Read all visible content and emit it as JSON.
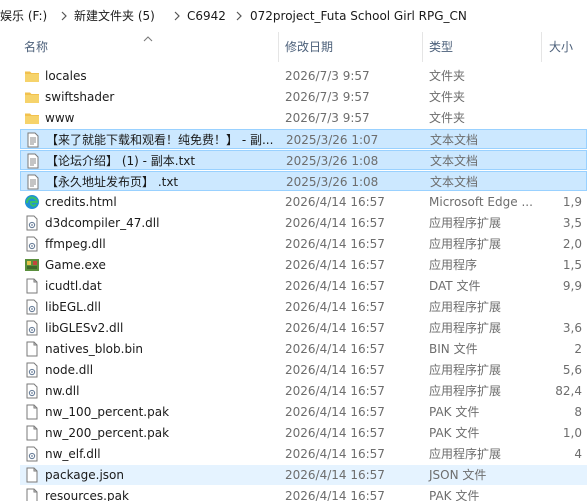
{
  "breadcrumb": [
    {
      "label": "娱乐 (F:)"
    },
    {
      "label": "新建文件夹 (5)"
    },
    {
      "label": "C6942"
    },
    {
      "label": "072project_Futa School Girl RPG_CN"
    }
  ],
  "columns": {
    "name": "名称",
    "date": "修改日期",
    "type": "类型",
    "size": "大小"
  },
  "colors": {
    "selected_bg": "#cce8ff",
    "selected_border": "#99d1ff",
    "hover_bg": "#e5f3ff",
    "folder": "#f2c14e"
  },
  "files": [
    {
      "name": "locales",
      "date": "2026/7/3 9:57",
      "type": "文件夹",
      "size": "",
      "icon": "folder-icon"
    },
    {
      "name": "swiftshader",
      "date": "2026/7/3 9:57",
      "type": "文件夹",
      "size": "",
      "icon": "folder-icon"
    },
    {
      "name": "www",
      "date": "2026/7/3 9:57",
      "type": "文件夹",
      "size": "",
      "icon": "folder-icon"
    },
    {
      "name": "【来了就能下载和观看！纯免费！】 - 副...",
      "date": "2025/3/26 1:07",
      "type": "文本文档",
      "size": "",
      "icon": "text-file-icon",
      "selected": true
    },
    {
      "name": "【论坛介绍】 (1) - 副本.txt",
      "date": "2025/3/26 1:08",
      "type": "文本文档",
      "size": "",
      "icon": "text-file-icon",
      "selected": true
    },
    {
      "name": "【永久地址发布页】 .txt",
      "date": "2025/3/26 1:08",
      "type": "文本文档",
      "size": "",
      "icon": "text-file-icon",
      "selected": true
    },
    {
      "name": "credits.html",
      "date": "2026/4/14 16:57",
      "type": "Microsoft Edge ...",
      "size": "1,9",
      "icon": "edge-icon"
    },
    {
      "name": "d3dcompiler_47.dll",
      "date": "2026/4/14 16:57",
      "type": "应用程序扩展",
      "size": "3,5",
      "icon": "dll-file-icon"
    },
    {
      "name": "ffmpeg.dll",
      "date": "2026/4/14 16:57",
      "type": "应用程序扩展",
      "size": "2,0",
      "icon": "dll-file-icon"
    },
    {
      "name": "Game.exe",
      "date": "2026/4/14 16:57",
      "type": "应用程序",
      "size": "1,5",
      "icon": "game-exe-icon"
    },
    {
      "name": "icudtl.dat",
      "date": "2026/4/14 16:57",
      "type": "DAT 文件",
      "size": "9,9",
      "icon": "blank-file-icon"
    },
    {
      "name": "libEGL.dll",
      "date": "2026/4/14 16:57",
      "type": "应用程序扩展",
      "size": "",
      "icon": "dll-file-icon"
    },
    {
      "name": "libGLESv2.dll",
      "date": "2026/4/14 16:57",
      "type": "应用程序扩展",
      "size": "3,6",
      "icon": "dll-file-icon"
    },
    {
      "name": "natives_blob.bin",
      "date": "2026/4/14 16:57",
      "type": "BIN 文件",
      "size": "2",
      "icon": "blank-file-icon"
    },
    {
      "name": "node.dll",
      "date": "2026/4/14 16:57",
      "type": "应用程序扩展",
      "size": "5,6",
      "icon": "dll-file-icon"
    },
    {
      "name": "nw.dll",
      "date": "2026/4/14 16:57",
      "type": "应用程序扩展",
      "size": "82,4",
      "icon": "dll-file-icon"
    },
    {
      "name": "nw_100_percent.pak",
      "date": "2026/4/14 16:57",
      "type": "PAK 文件",
      "size": "8",
      "icon": "blank-file-icon"
    },
    {
      "name": "nw_200_percent.pak",
      "date": "2026/4/14 16:57",
      "type": "PAK 文件",
      "size": "1,0",
      "icon": "blank-file-icon"
    },
    {
      "name": "nw_elf.dll",
      "date": "2026/4/14 16:57",
      "type": "应用程序扩展",
      "size": "4",
      "icon": "dll-file-icon"
    },
    {
      "name": "package.json",
      "date": "2026/4/14 16:57",
      "type": "JSON 文件",
      "size": "",
      "icon": "blank-file-icon",
      "hover": true
    },
    {
      "name": "resources.pak",
      "date": "2026/4/14 16:57",
      "type": "PAK 文件",
      "size": "",
      "icon": "blank-file-icon"
    }
  ]
}
